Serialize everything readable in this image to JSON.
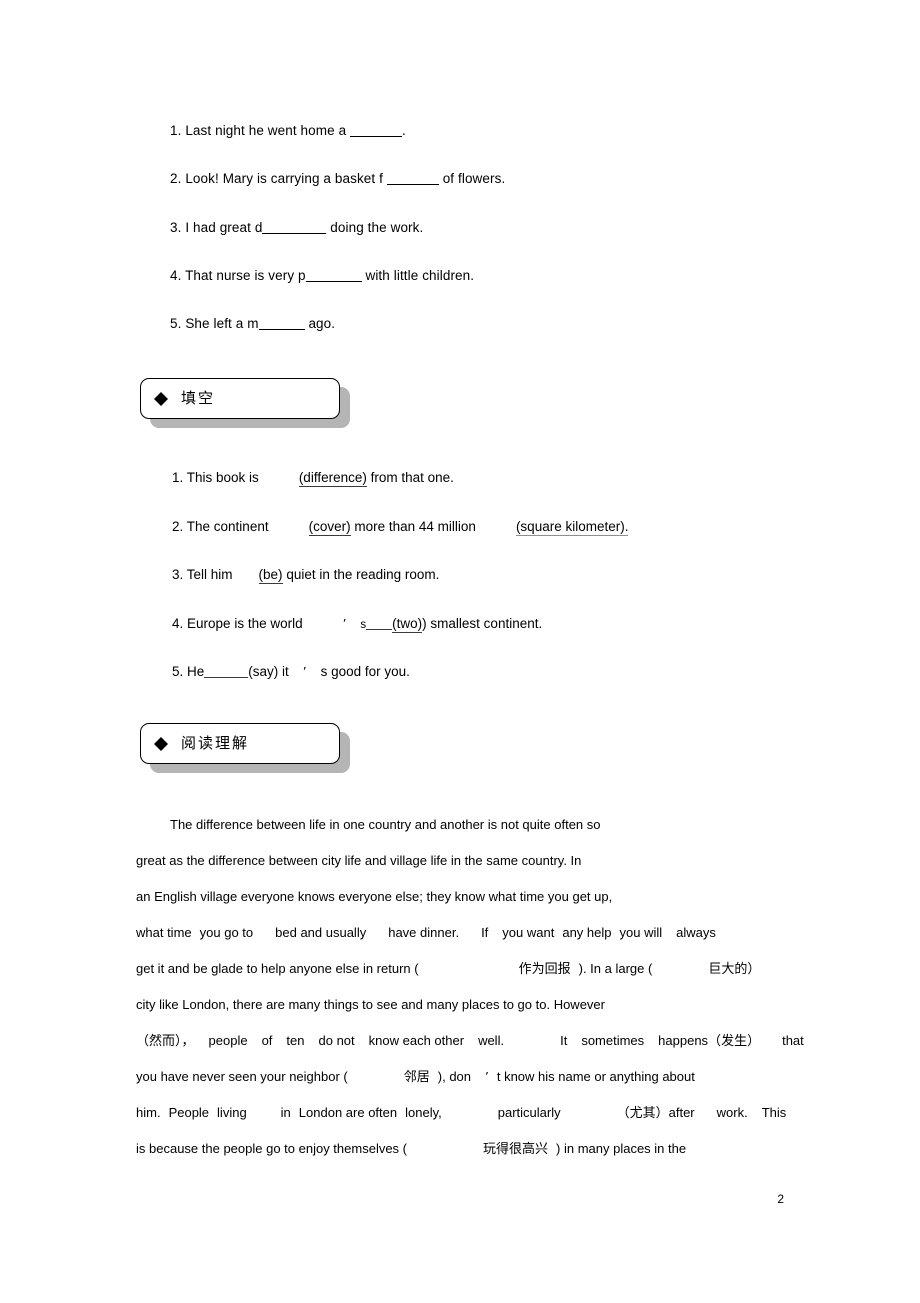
{
  "word_fill_exercises": [
    {
      "num": "1.",
      "pre": "Last night he went home a",
      "post": "."
    },
    {
      "num": "2.",
      "pre": "Look! Mary is carrying a basket f",
      "post": "of flowers."
    },
    {
      "num": "3.",
      "pre": "I had great d",
      "post": "doing the work."
    },
    {
      "num": "4.",
      "pre": "That nurse is very p",
      "post": "with little children."
    },
    {
      "num": "5.",
      "pre": "She left a m",
      "post": "ago."
    }
  ],
  "sections": [
    {
      "marker": "diamond",
      "label": "填空"
    },
    {
      "marker": "diamond",
      "label": "阅读理解"
    }
  ],
  "blank_fill_exercises": [
    {
      "num": "1.",
      "parts": [
        "This book is",
        "(difference)",
        "from that one."
      ]
    },
    {
      "num": "2.",
      "parts": [
        "The continent",
        "(cover)",
        "more than 44 million",
        "(square kilometer)."
      ]
    },
    {
      "num": "3.",
      "parts": [
        "Tell him",
        "(be)",
        "quiet in the reading room."
      ]
    },
    {
      "num": "4.",
      "parts": [
        "Europe is the world",
        "’",
        "s",
        "(two)",
        ") smallest continent."
      ]
    },
    {
      "num": "5.",
      "parts": [
        "He",
        "(say) it",
        "’",
        "s good for you."
      ]
    }
  ],
  "reading_passage": {
    "lines": [
      "The difference between life in one country and another is not quite often so",
      "great as the difference between city life and village life in the same country. In",
      "an English village everyone knows everyone else; they know what time you get up,",
      "what time  you go to    bed and usually    have dinner.    If   you want  any help  you will   always",
      "get it and be glade to help anyone else in return (                     作为回报 ). In a large (        巨大的 )",
      "city like London, there are many things to see and many places to go to. However",
      "（然而），  people  of  ten  do not  know each other  well.     It  sometimes  happens（发生）   that",
      "you have never seen your neighbor (           邻居 ), don  ’ t know his name or anything about",
      "him.  People  living      in  London are often  lonely,        particularly        （尤其）after    work.   This",
      "is because the people go to enjoy themselves (              玩得很高兴 ) in many places in the"
    ],
    "line1_words": {
      "text": "The difference between life in one country and another is not quite often so"
    },
    "line2_words": {
      "text": "great as the difference between city life and village life in the same country. In"
    },
    "line3_words": {
      "text": "an English village everyone knows everyone else; they know what time you get up,"
    },
    "line4_words": {
      "a": "what time",
      "b": "you go to",
      "c": "bed and usually",
      "d": "have dinner.",
      "e": "If",
      "f": "you want",
      "g": "any help",
      "h": "you will",
      "i": "always"
    },
    "line5_words": {
      "a": "get it and be glade to help anyone else in return (",
      "cn1": "作为回报",
      "b": "). In a large (",
      "cn2": "巨大的",
      "c": "）"
    },
    "line6_words": {
      "text": "city like London, there are many things to see and many places to go to. However"
    },
    "line7_words": {
      "cn1": "（然而）",
      "a": "，",
      "b": "people",
      "c": "of",
      "d": "ten",
      "e": "do not",
      "f": "know each other",
      "g": "well.",
      "h": "It",
      "i": "sometimes",
      "j": "happens（",
      "cn2": "发生",
      "k": "）",
      "l": "that"
    },
    "line8_words": {
      "a": "you have never seen your neighbor (",
      "cn1": "邻居",
      "b": "), don",
      "apos": "’",
      "c": "t know his name or anything about"
    },
    "line9_words": {
      "a": "him.",
      "b": "People",
      "c": "living",
      "d": "in",
      "e": "London are often",
      "f": "lonely,",
      "g": "particularly",
      "cn1": "（尤其）",
      "h": "after",
      "i": "work.",
      "j": "This"
    },
    "line10_words": {
      "a": "is because the people go to enjoy themselves (",
      "cn1": "玩得很高兴",
      "b": ") in many places in the"
    }
  },
  "page_number": "2"
}
